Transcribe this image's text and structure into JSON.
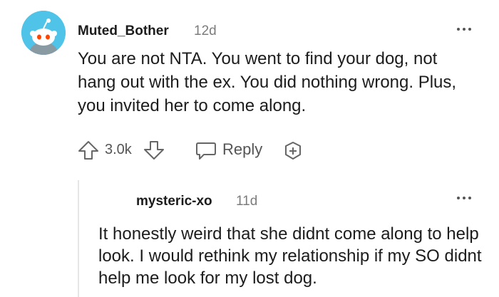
{
  "comment": {
    "author": "Muted_Bother",
    "age": "12d",
    "text": "You are not NTA. You went to find your dog, not hang out with the ex. You did nothing wrong. Plus, you invited her to come along.",
    "score": "3.0k",
    "reply_label": "Reply"
  },
  "reply": {
    "author": "mysteric-xo",
    "age": "11d",
    "text": "It honestly weird that she didnt come along to help look. I would rethink my relationship if my SO didnt help me look for my lost dog."
  },
  "icons": {
    "avatar": "snoo-avatar",
    "upvote": "arrow-up-icon",
    "downvote": "arrow-down-icon",
    "reply": "speech-bubble-icon",
    "award": "award-plus-icon",
    "more": "more-dots-icon"
  },
  "colors": {
    "avatar_bg": "#4fc3e8",
    "text": "#1c1c1c",
    "meta": "#7c7c7c"
  }
}
